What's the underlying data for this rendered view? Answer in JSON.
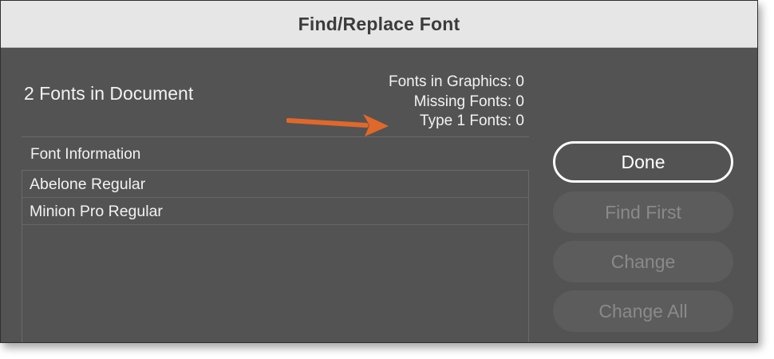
{
  "window": {
    "title": "Find/Replace Font"
  },
  "summary": {
    "doc_fonts": "2 Fonts in Document",
    "stats": [
      "Fonts in Graphics: 0",
      "Missing Fonts: 0",
      "Type 1 Fonts: 0"
    ]
  },
  "font_list": {
    "header": "Font Information",
    "items": [
      "Abelone Regular",
      "Minion Pro Regular"
    ]
  },
  "buttons": {
    "done": "Done",
    "find_first": "Find First",
    "change": "Change",
    "change_all": "Change All"
  },
  "annotation": {
    "arrow_color": "#e0682a",
    "arrow_icon": "arrow-right-icon"
  },
  "colors": {
    "dialog_bg": "#535353",
    "titlebar_bg": "#e6e6e6",
    "text": "#f2f2f2",
    "disabled_text": "#8a8a8a"
  }
}
